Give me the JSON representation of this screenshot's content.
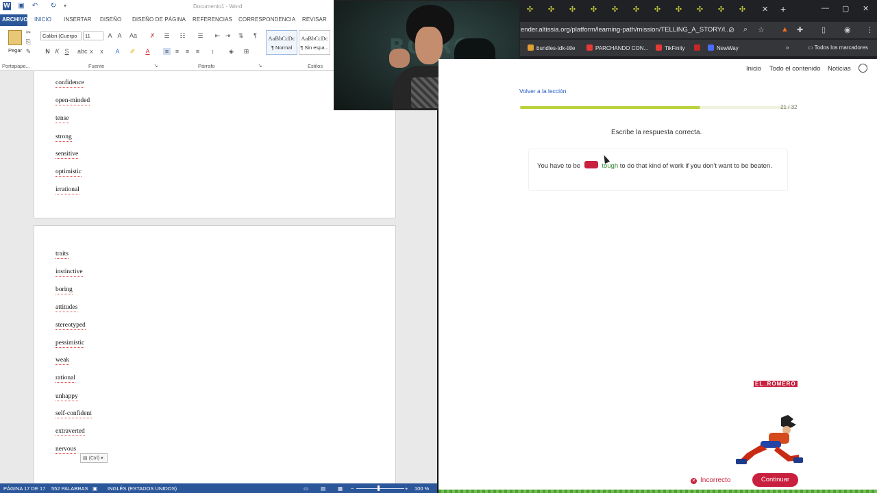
{
  "word": {
    "window_title": "Documento1 - Word",
    "tabs": [
      "ARCHIVO",
      "INICIO",
      "INSERTAR",
      "DISEÑO",
      "DISEÑO DE PÁGINA",
      "REFERENCIAS",
      "CORRESPONDENCIA",
      "REVISAR"
    ],
    "ribbon": {
      "paste_label": "Pegar",
      "font_name": "Calibri (Cuerpo",
      "font_size": "11",
      "group_clipboard": "Portapape...",
      "group_font": "Fuente",
      "group_paragraph": "Párrafo",
      "group_styles": "Estilos",
      "style_sample": "AaBbCcDc",
      "style_normal": "¶ Normal",
      "style_nospacing": "¶ Sin espa..."
    },
    "page1_words": [
      "confidence",
      "open-minded",
      "tense",
      "strong",
      "sensitive",
      "optimistic",
      "irrational"
    ],
    "page2_words": [
      "traits",
      "instinctive",
      "boring",
      "attitudes",
      "stereotyped",
      "pessimistic",
      "weak",
      "rational",
      "unhappy",
      "self-confident",
      "extraverted",
      "nervous"
    ],
    "paste_options": "(Ctrl)",
    "status": {
      "page": "PÁGINA 17 DE 17",
      "words": "552 PALABRAS",
      "language": "INGLÉS (ESTADOS UNIDOS)",
      "zoom": "100 %"
    }
  },
  "camera": {
    "logo_text": "RO  RO"
  },
  "browser": {
    "url": "ender.altissia.org/platform/learning-path/mission/TELLING_A_STORY/l...",
    "bookmarks": [
      "bundles-tdk-title",
      "PARCHANDO CON...",
      "TikFinity",
      "NewWay"
    ],
    "all_bookmarks": "Todos los marcadores",
    "bookmark_colors": [
      "#e0a030",
      "#e53935",
      "#e53935",
      "#4a6cf7"
    ]
  },
  "site": {
    "nav": [
      "Inicio",
      "Todo el contenido",
      "Noticias"
    ],
    "back_link": "Volver a la lección",
    "progress": {
      "current": 21,
      "total": 32,
      "label": "21 / 32"
    },
    "instruction": "Escribe la respuesta correcta.",
    "question": {
      "before": "You have to be",
      "answer": "tough",
      "after": "to do that kind of work if you don't want to be beaten."
    },
    "streamer_tag": "EL_ROMERO",
    "incorrect_label": "Incorrecto",
    "continue_label": "Continuar",
    "accent_color": "#c8203e",
    "progress_color": "#b9d23c"
  }
}
